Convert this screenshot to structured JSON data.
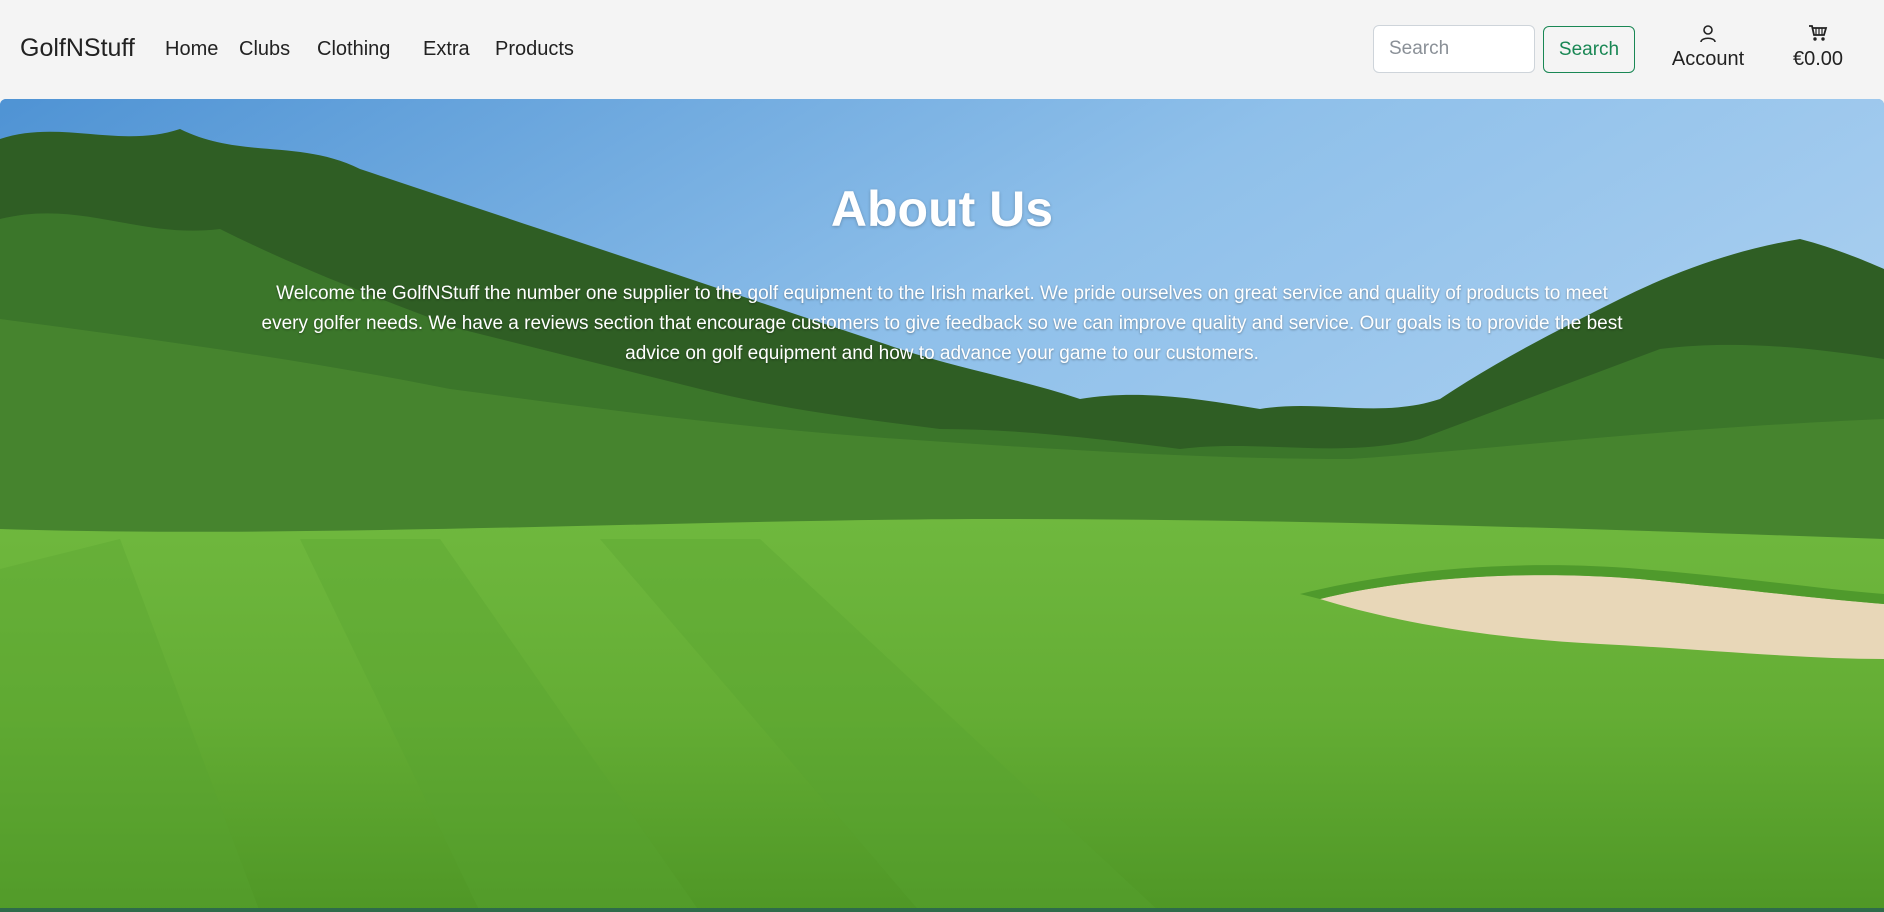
{
  "brand": "GolfNStuff",
  "nav": {
    "home": "Home",
    "clubs": "Clubs",
    "clothing": "Clothing",
    "extra": "Extra",
    "products": "Products"
  },
  "search": {
    "placeholder": "Search",
    "button_label": "Search"
  },
  "account": {
    "label": "Account",
    "icon": "person-icon"
  },
  "cart": {
    "total": "€0.00",
    "icon": "cart-icon"
  },
  "hero": {
    "title": "About Us",
    "text": "Welcome the GolfNStuff the number one supplier to the golf equipment to the Irish market. We pride ourselves on great service and quality of products to meet every golfer needs. We have a reviews section that encourage customers to give feedback so we can improve quality and service. Our goals is to provide the best advice on golf equipment and how to advance your game to our customers."
  },
  "colors": {
    "accent": "#198754",
    "navbar_bg": "#f4f4f4",
    "hero_text": "#ffffff"
  }
}
